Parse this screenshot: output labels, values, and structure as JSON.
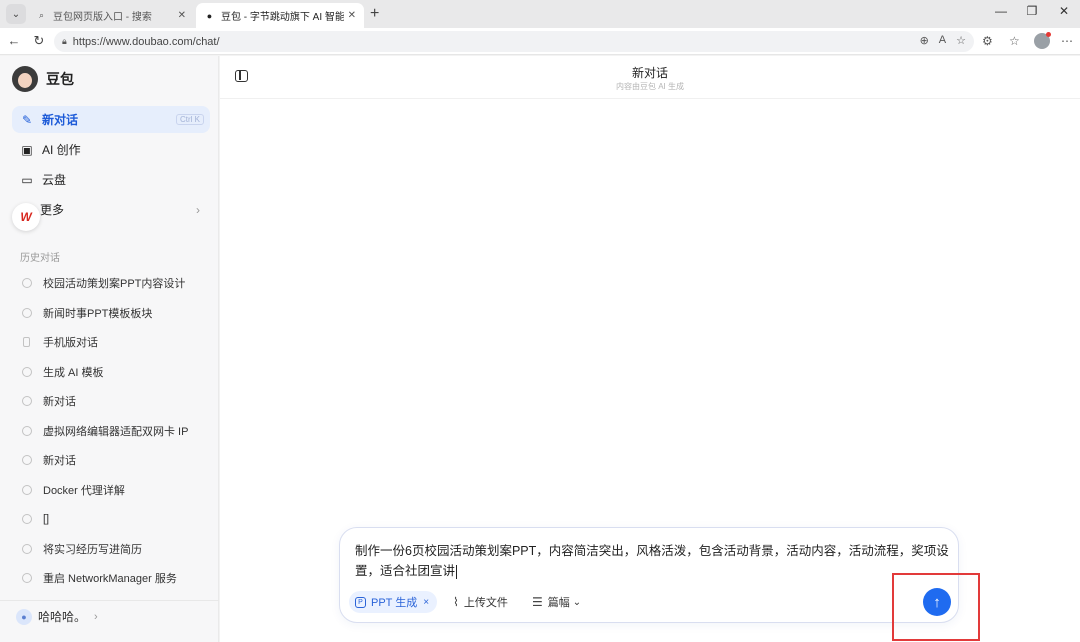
{
  "browser": {
    "tabs": [
      {
        "title": "豆包网页版入口 - 搜索",
        "close": "✕"
      },
      {
        "title": "豆包 - 字节跳动旗下 AI 智能助手",
        "close": "✕"
      }
    ],
    "new_tab": "+",
    "window": {
      "minimize": "—",
      "restore": "❐",
      "close": "✕"
    },
    "url": "https://www.doubao.com/chat/"
  },
  "sidebar": {
    "brand": "豆包",
    "nav": [
      {
        "label": "新对话",
        "icon": "edit-icon",
        "shortcut": "Ctrl K"
      },
      {
        "label": "AI 创作",
        "icon": "image-icon"
      },
      {
        "label": "云盘",
        "icon": "folder-icon"
      },
      {
        "label": "更多",
        "icon": "grid-icon",
        "chevron": "›"
      }
    ],
    "history_label": "历史对话",
    "history": [
      "校园活动策划案PPT内容设计",
      "新闻时事PPT模板板块",
      "手机版对话",
      "生成 AI 模板",
      "新对话",
      "虚拟网络编辑器适配双网卡 IP",
      "新对话",
      "Docker 代理详解",
      "[]",
      "将实习经历写进简历",
      "重启 NetworkManager 服务"
    ],
    "user": {
      "name": "哈哈哈。",
      "chevron": "›"
    }
  },
  "main": {
    "title": "新对话",
    "subtitle": "内容由豆包 AI 生成",
    "composer": {
      "text": "制作一份6页校园活动策划案PPT，内容简洁突出，风格活泼，包含活动背景，活动内容，活动流程，奖项设置，适合社团宣讲",
      "chip_label": "PPT 生成",
      "chip_close": "×",
      "upload_label": "上传文件",
      "length_label": "篇幅",
      "length_chevron": "⌄",
      "send_glyph": "↑"
    }
  },
  "colors": {
    "accent": "#1f6bf0",
    "highlight_box": "#e23a3a"
  }
}
